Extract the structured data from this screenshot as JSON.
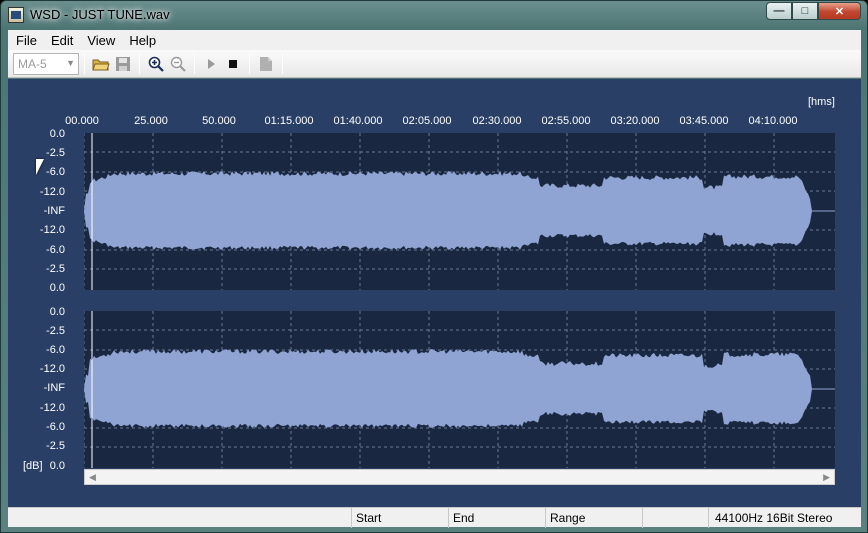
{
  "window": {
    "title": "WSD - JUST TUNE.wav"
  },
  "caption": {
    "minimize": "0",
    "maximize": "1",
    "close": "r"
  },
  "menu": [
    "File",
    "Edit",
    "View",
    "Help"
  ],
  "toolbar": {
    "preset": "MA-5"
  },
  "timeline": {
    "unit": "[hms]",
    "ticks": [
      "00.000",
      "25.000",
      "50.000",
      "01:15.000",
      "01:40.000",
      "02:05.000",
      "02:30.000",
      "02:55.000",
      "03:20.000",
      "03:45.000",
      "04:10.000"
    ]
  },
  "channels": [
    {
      "db_labels": [
        "0.0",
        "-2.5",
        "-6.0",
        "-12.0",
        "-INF",
        "-12.0",
        "-6.0",
        "-2.5",
        "0.0"
      ]
    },
    {
      "db_labels": [
        "0.0",
        "-2.5",
        "-6.0",
        "-12.0",
        "-INF",
        "-12.0",
        "-6.0",
        "-2.5",
        "0.0"
      ]
    }
  ],
  "db_unit": "[dB]",
  "status": {
    "start": "Start",
    "end": "End",
    "range": "Range",
    "format": "44100Hz 16Bit Stereo"
  },
  "colors": {
    "background": "#2a3f66",
    "waveform": "#8fa4d2",
    "channel_bg": "#1a2740",
    "grid": "#6a7a92"
  }
}
